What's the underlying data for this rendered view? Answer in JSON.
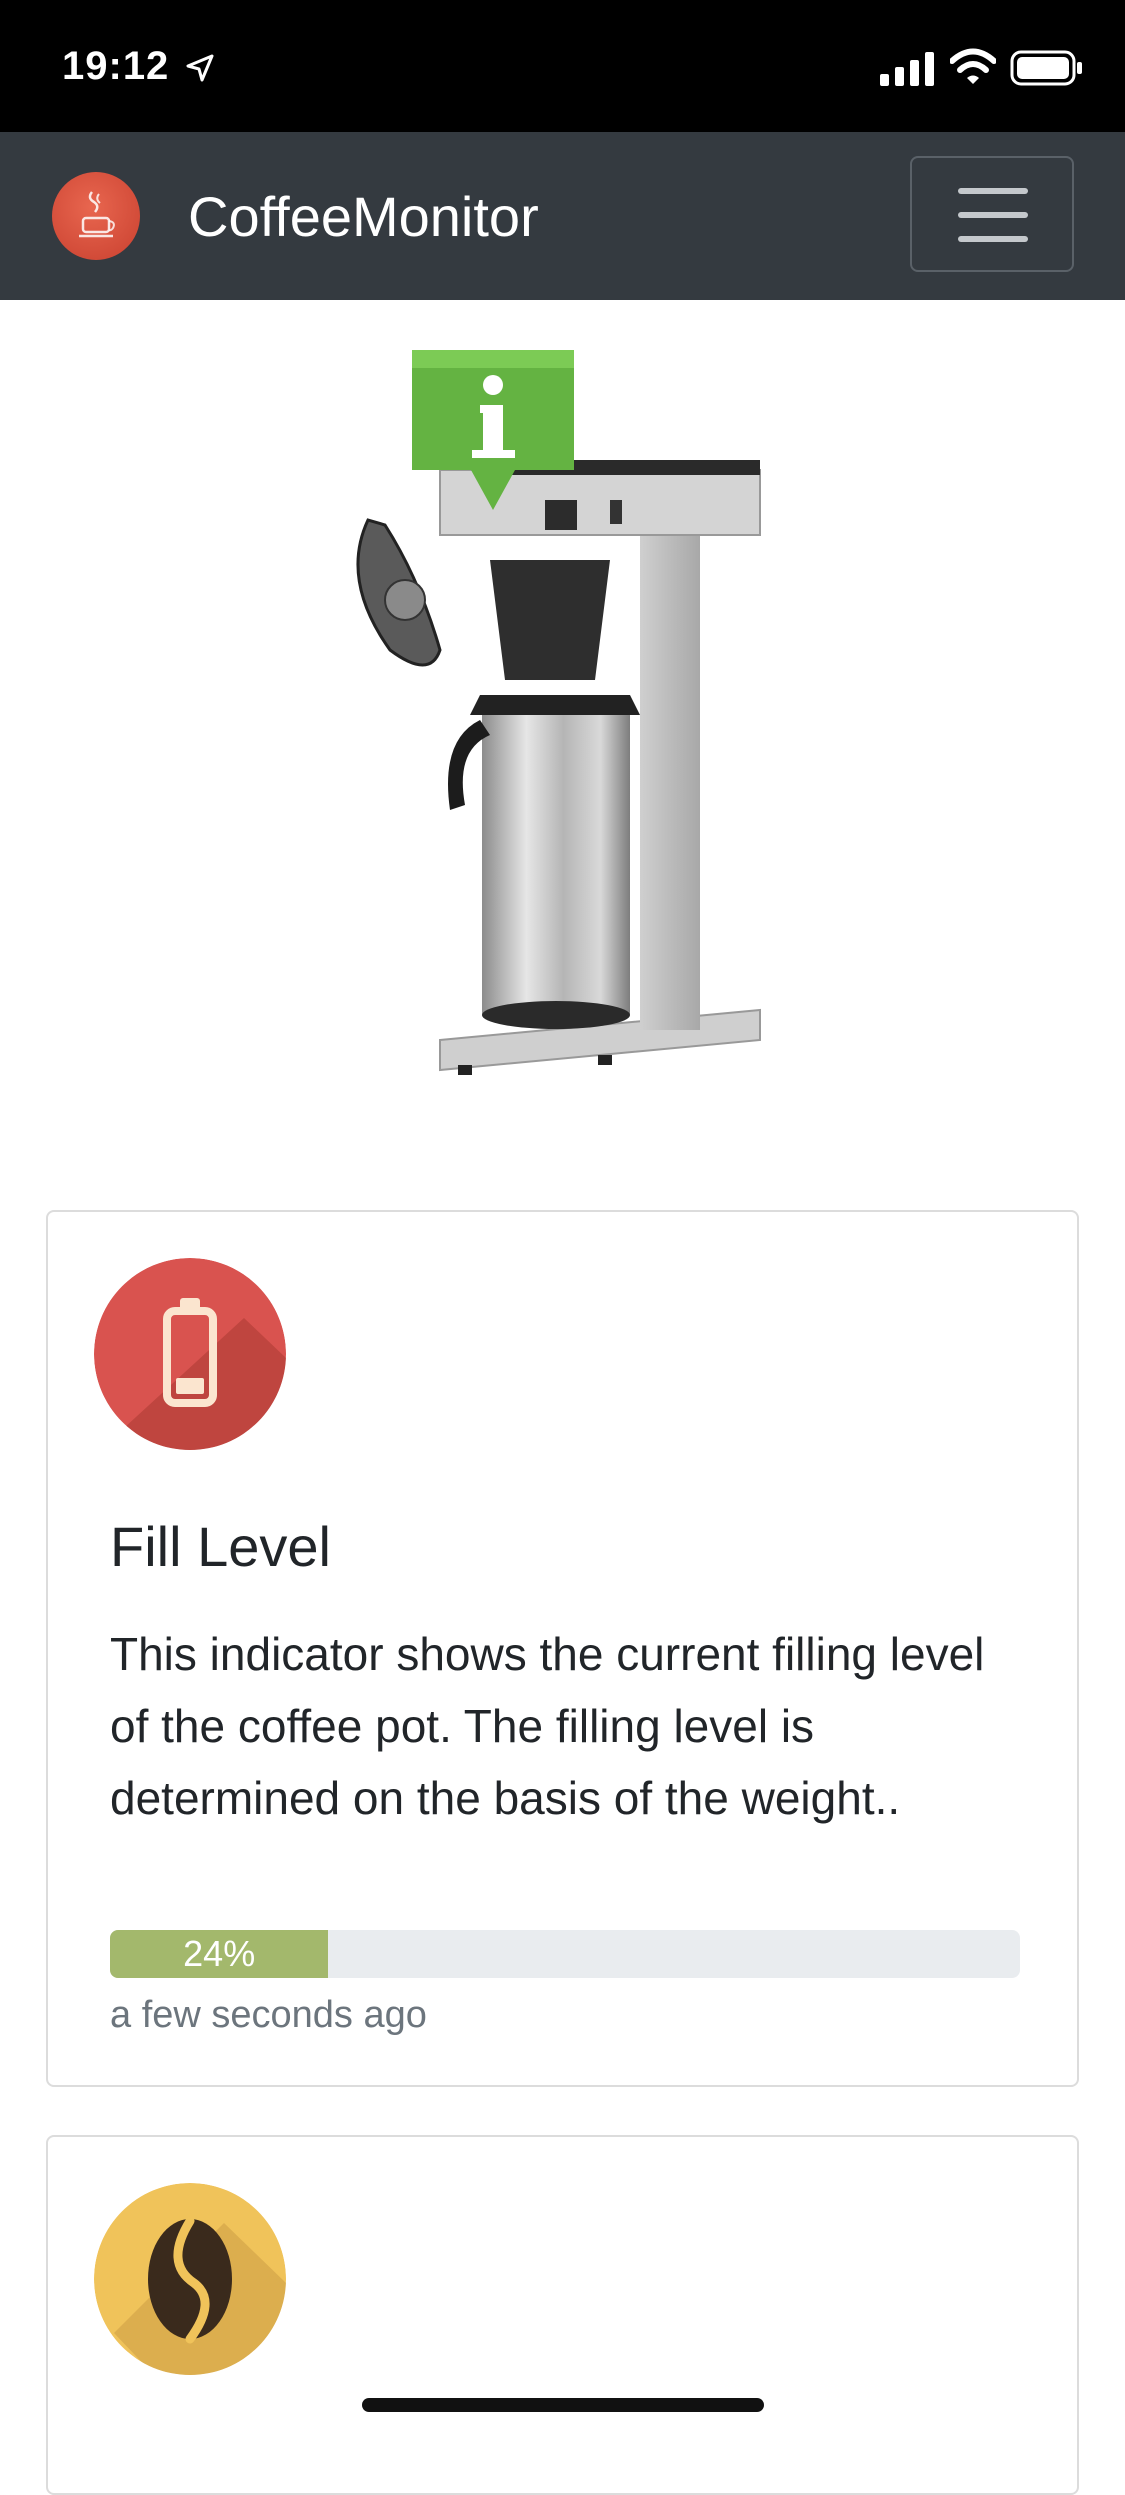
{
  "status_bar": {
    "time": "19:12"
  },
  "navbar": {
    "brand": "CoffeeMonitor"
  },
  "hero": {
    "image_alt": "Coffee machine with info marker"
  },
  "cards": [
    {
      "icon": "battery-icon",
      "icon_color": "#d9534f",
      "title": "Fill Level",
      "text": "This indicator shows the current filling level of the coffee pot. The filling level is determined on the basis of the weight..",
      "progress_percent": 24,
      "progress_label": "24%",
      "progress_color": "#a3b86c",
      "updated": "a few seconds ago"
    },
    {
      "icon": "coffee-bean-icon",
      "icon_color": "#f0c35a"
    }
  ]
}
